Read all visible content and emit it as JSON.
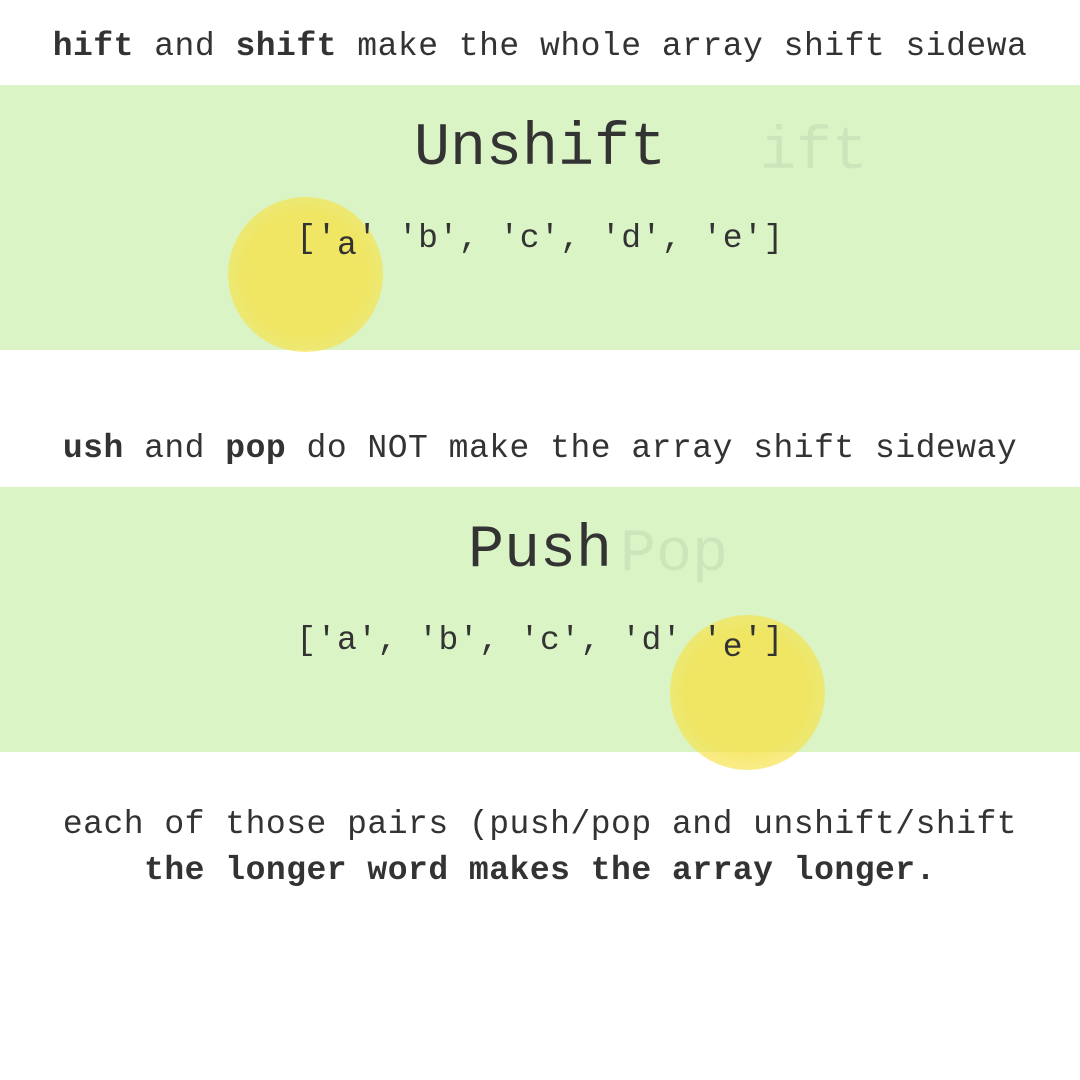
{
  "line1": {
    "prefix_cut": "hift",
    "and": " and ",
    "bold2": "shift",
    "rest": " make the whole array shift sidewa"
  },
  "panel1": {
    "title": "Unshift",
    "ghost": "ift",
    "array_open": "['",
    "array_moving": "a",
    "array_mid": "'  'b', 'c', 'd', 'e']"
  },
  "line2": {
    "prefix_cut": "ush",
    "and": " and ",
    "bold2": "pop",
    "rest": " do NOT make the array shift sideway"
  },
  "panel2": {
    "title": "Push",
    "ghost": "Pop",
    "array_start": "['a', 'b', 'c', 'd'  '",
    "array_moving": "e",
    "array_end": "']"
  },
  "footer": {
    "line1": "each of those pairs (push/pop and unshift/shift",
    "line2": "the longer word makes the array longer."
  }
}
